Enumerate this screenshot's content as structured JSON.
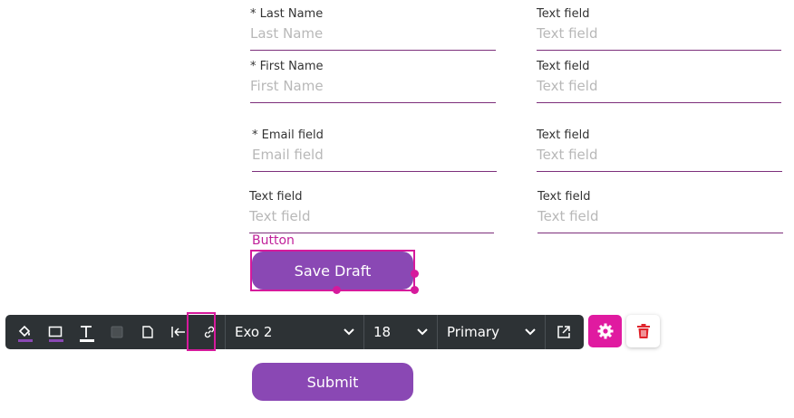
{
  "form": {
    "fields": [
      {
        "label": "* Last Name",
        "placeholder": "Last Name"
      },
      {
        "label": "Text field",
        "placeholder": "Text field"
      },
      {
        "label": "* First Name",
        "placeholder": "First Name"
      },
      {
        "label": "Text field",
        "placeholder": "Text field"
      },
      {
        "label": "* Email field",
        "placeholder": "Email field"
      },
      {
        "label": "Text field",
        "placeholder": "Text field"
      },
      {
        "label": "Text field",
        "placeholder": "Text field"
      },
      {
        "label": "Text field",
        "placeholder": "Text field"
      }
    ],
    "button_caption": "Button",
    "save_draft_label": "Save Draft",
    "submit_label": "Submit"
  },
  "toolbar": {
    "font_family": "Exo 2",
    "font_size": "18",
    "style": "Primary",
    "icons": [
      "fill-color-icon",
      "border-color-icon",
      "text-color-icon",
      "background-square-icon",
      "file-icon",
      "align-left-icon",
      "link-icon",
      "external-link-icon",
      "gear-icon",
      "trash-icon"
    ]
  },
  "colors": {
    "accent": "#d61a9c",
    "button": "#8a48b4",
    "toolbar": "#2d3235",
    "underline": "#7d2f7b",
    "delete": "#e0242c"
  }
}
